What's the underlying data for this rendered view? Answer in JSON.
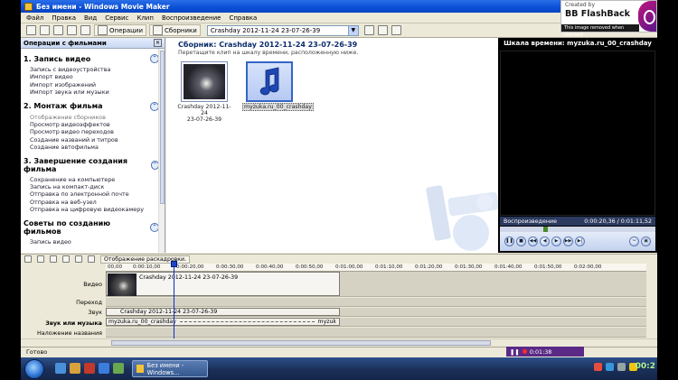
{
  "window": {
    "title": "Без имени - Windows Movie Maker"
  },
  "menu": [
    "Файл",
    "Правка",
    "Вид",
    "Сервис",
    "Клип",
    "Воспроизведение",
    "Справка"
  ],
  "toolbar": {
    "tasks_label": "Операции",
    "collections_label": "Сборники",
    "collection_combo_value": "Crashday 2012-11-24 23-07-26-39"
  },
  "taskpane": {
    "header": "Операции с фильмами",
    "sections": [
      {
        "title": "1. Запись видео",
        "items": [
          "Запись с видеоустройства",
          "Импорт видео",
          "Импорт изображений",
          "Импорт звука или музыки"
        ]
      },
      {
        "title": "2. Монтаж фильма",
        "items": [
          "Отображение сборников",
          "Просмотр видеоэффектов",
          "Просмотр видео переходов",
          "Создание названий и титров",
          "Создание автофильма"
        ]
      },
      {
        "title": "3. Завершение создания фильма",
        "items": [
          "Сохранение на компьютере",
          "Запись на компакт-диск",
          "Отправка по электронной почте",
          "Отправка на веб-узел",
          "Отправка на цифровую видеокамеру"
        ]
      },
      {
        "title": "Советы по созданию фильмов",
        "items": [
          "Запись видео"
        ]
      }
    ]
  },
  "collection": {
    "title": "Сборник: Crashday 2012-11-24 23-07-26-39",
    "subtitle": "Перетащите клип на шкалу времени, расположенную ниже.",
    "clips": [
      {
        "type": "video",
        "label_line1": "Crashday 2012-11-24",
        "label_line2": "23-07-26-39"
      },
      {
        "type": "audio",
        "label_line1": "myzuka.ru_00_crashday",
        "label_line2": ""
      }
    ]
  },
  "preview": {
    "title": "Шкала времени: myzuka.ru_00_crashday",
    "status": "Воспроизведение",
    "time": "0:00:20,36 / 0:01:11,52",
    "seek_fraction": 0.29
  },
  "timeline": {
    "mode_label": "Отображение раскадровки.",
    "ruler": [
      "00,00",
      "0:00:10,00",
      "0:00:20,00",
      "0:00:30,00",
      "0:00:40,00",
      "0:00:50,00",
      "0:01:00,00",
      "0:01:10,00",
      "0:01:20,00",
      "0:01:30,00",
      "0:01:40,00",
      "0:01:50,00",
      "0:02:00,00"
    ],
    "tracks": {
      "video": "Видео",
      "transition": "Переход",
      "audio": "Звук",
      "music": "Звук или музыка",
      "titles": "Наложение названия"
    },
    "video_clip": "Crashday 2012-11-24 23-07-26-39",
    "audio_clip": "Crashday 2012-11-24 23-07-26-39",
    "music_clip_start": "myzuka.ru_00_crashday",
    "music_clip_end": "myzuk"
  },
  "status": {
    "text": "Готово"
  },
  "recorder": {
    "time": "0:01:38"
  },
  "taskbar": {
    "task_label": "Без имени - Windows...",
    "clock": "00:2"
  },
  "badge": {
    "created_by": "Created by",
    "brand": "BB FlashBack",
    "note": "This image removed when licensed"
  }
}
